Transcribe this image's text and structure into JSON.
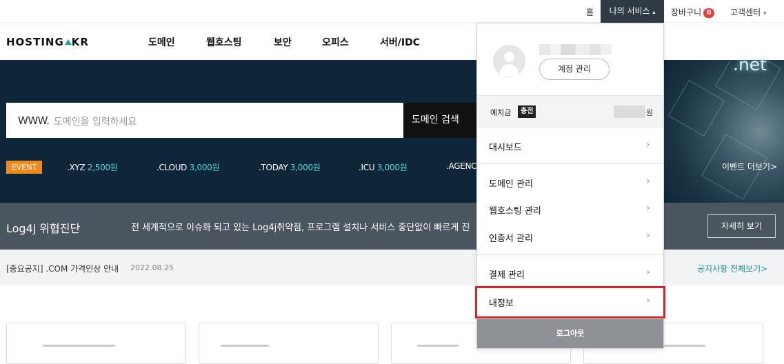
{
  "topbar": {
    "home": "홈",
    "my_service": "나의 서비스",
    "my_service_caret": "▴",
    "cart": "장바구니",
    "cart_count": "0",
    "support": "고객센터",
    "support_caret": "▾"
  },
  "header": {
    "logo_left": "HOSTING",
    "logo_right": "KR",
    "nav": [
      "도메인",
      "웹호스팅",
      "보안",
      "오피스",
      "서버/IDC"
    ]
  },
  "hero": {
    "www": "WWW.",
    "search_placeholder": "도메인을 입력하세요",
    "search_button": "도메인 검색",
    "event_badge": "EVENT",
    "prices": [
      {
        "tld": ".XYZ",
        "price": "2,500원"
      },
      {
        "tld": ".CLOUD",
        "price": "3,000원"
      },
      {
        "tld": ".TODAY",
        "price": "3,000원"
      },
      {
        "tld": ".ICU",
        "price": "3,000원"
      },
      {
        "tld": ".AGENC",
        "price": ""
      }
    ],
    "banner_text": ".net",
    "event_more": "이벤트 더보기>"
  },
  "log4j": {
    "title": "Log4j 위협진단",
    "description": "전 세계적으로 이슈화 되고 있는 Log4j취약점, 프로그램 설치나 서비스 중단없이 빠르게 진",
    "more_button": "자세히 보기"
  },
  "notice": {
    "text": "[중요공지] .COM 가격인상 안내",
    "date": "2022.08.25",
    "view_all": "공지사항 전체보기>"
  },
  "dropdown": {
    "account_button": "계정 관리",
    "deposit_label": "예치금",
    "charge_label": "충전",
    "currency": "원",
    "items": [
      {
        "label": "대시보드",
        "chevron": "›"
      },
      {
        "label": "도메인 관리",
        "chevron": "›"
      },
      {
        "label": "웹호스팅 관리",
        "chevron": "›"
      },
      {
        "label": "인증서 관리",
        "chevron": "›"
      },
      {
        "label": "결제 관리",
        "chevron": "›"
      },
      {
        "label": "내정보",
        "chevron": "›"
      }
    ],
    "logout": "로그아웃"
  },
  "colors": {
    "accent_teal": "#1aa3a8",
    "event_orange": "#f08a1c",
    "highlight_red": "#dc2027",
    "price_cyan": "#4fd6e0",
    "cart_badge": "#e43a3a"
  },
  "icons": {
    "avatar": "user-avatar-icon",
    "chevron": "chevron-right-icon"
  }
}
